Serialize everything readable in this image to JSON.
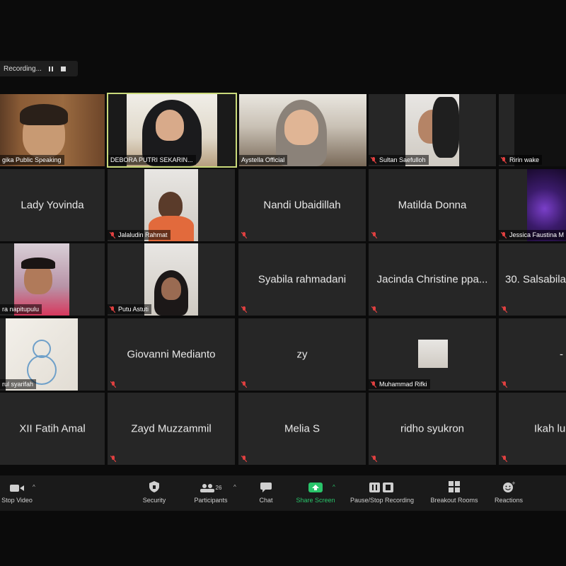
{
  "recording": {
    "label": "Recording..."
  },
  "grid": {
    "tiles": [
      {
        "id": "t00",
        "name": "gika Public Speaking",
        "video": true
      },
      {
        "id": "t01",
        "name": "DEBORA PUTRI SEKARIN...",
        "video": true,
        "active_speaker": true
      },
      {
        "id": "t02",
        "name": "Aystella Official",
        "video": true
      },
      {
        "id": "t03",
        "name": "Sultan Saefulloh",
        "video": true,
        "muted": true
      },
      {
        "id": "t04",
        "name": "Ririn wake",
        "video": true,
        "muted": true
      },
      {
        "id": "t10",
        "name": "Lady Yovinda",
        "video": false
      },
      {
        "id": "t11",
        "name": "Jalaludin Rahmat",
        "video": true,
        "muted": true
      },
      {
        "id": "t12",
        "name": "Nandi Ubaidillah",
        "video": false,
        "muted": true
      },
      {
        "id": "t13",
        "name": "Matilda Donna",
        "video": false,
        "muted": true
      },
      {
        "id": "t14",
        "name": "Jessica Faustina M",
        "video": true,
        "muted": true
      },
      {
        "id": "t20",
        "name": "ra napitupulu",
        "video": true
      },
      {
        "id": "t21",
        "name": "Putu Astuti",
        "video": true,
        "muted": true
      },
      {
        "id": "t22",
        "name": "Syabila rahmadani",
        "video": false,
        "muted": true
      },
      {
        "id": "t23",
        "name": "Jacinda Christine ppa...",
        "video": false,
        "muted": true
      },
      {
        "id": "t24",
        "name": "30. Salsabila",
        "video": false,
        "muted": true
      },
      {
        "id": "t30",
        "name": "rul syarifah",
        "video": true
      },
      {
        "id": "t31",
        "name": "Giovanni Medianto",
        "video": false,
        "muted": true
      },
      {
        "id": "t32",
        "name": "zy",
        "video": false,
        "muted": true
      },
      {
        "id": "t33",
        "name": "Muhammad Rifki",
        "video": true,
        "muted": true
      },
      {
        "id": "t34",
        "name": "-",
        "video": false,
        "muted": true
      },
      {
        "id": "t40",
        "name": "XII Fatih Amal",
        "video": false
      },
      {
        "id": "t41",
        "name": "Zayd Muzzammil",
        "video": false,
        "muted": true
      },
      {
        "id": "t42",
        "name": "Melia S",
        "video": false,
        "muted": true
      },
      {
        "id": "t43",
        "name": "ridho syukron",
        "video": false,
        "muted": true
      },
      {
        "id": "t44",
        "name": "Ikah lu",
        "video": false,
        "muted": true
      }
    ]
  },
  "toolbar": {
    "stop_video": "Stop Video",
    "security": "Security",
    "participants": "Participants",
    "participants_count": "26",
    "chat": "Chat",
    "share_screen": "Share Screen",
    "pause_stop_recording": "Pause/Stop Recording",
    "breakout_rooms": "Breakout Rooms",
    "reactions": "Reactions"
  },
  "colors": {
    "share_green": "#29c46a",
    "speaker_border": "#c9d97a",
    "tile_bg": "#262626"
  }
}
